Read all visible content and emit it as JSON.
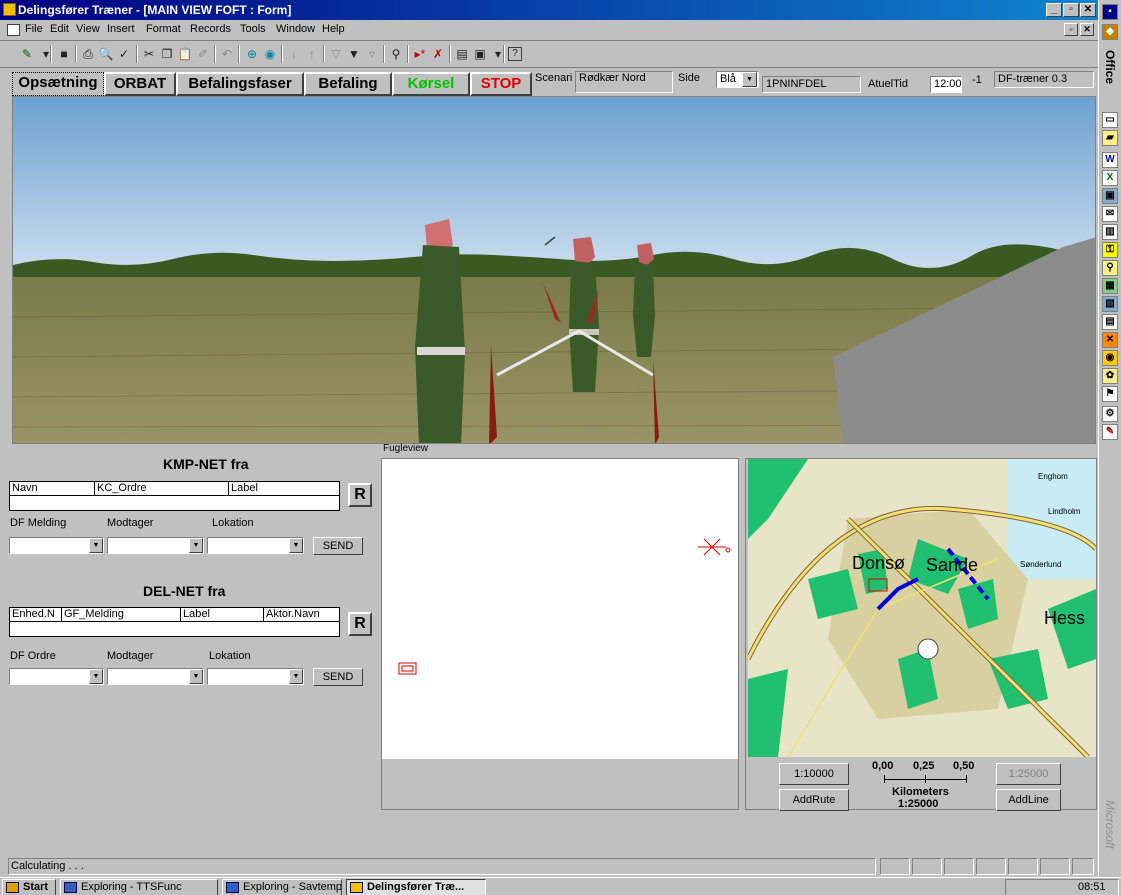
{
  "window": {
    "title": "Delingsfører Træner - [MAIN VIEW FOFT : Form]"
  },
  "menu": {
    "items": [
      "File",
      "Edit",
      "View",
      "Insert",
      "Format",
      "Records",
      "Tools",
      "Window",
      "Help"
    ]
  },
  "toolbar": {
    "icons": [
      "design-view-icon",
      "save-icon",
      "print-icon",
      "print-preview-icon",
      "spelling-icon",
      "cut-icon",
      "copy-icon",
      "paste-icon",
      "format-painter-icon",
      "undo-icon",
      "insert-hyperlink-icon",
      "web-toolbar-icon",
      "sort-ascending-icon",
      "sort-descending-icon",
      "filter-by-selection-icon",
      "filter-by-form-icon",
      "apply-filter-icon",
      "find-icon",
      "new-record-icon",
      "delete-record-icon",
      "database-window-icon",
      "new-object-icon",
      "help-icon"
    ]
  },
  "controls": {
    "tab_opsaetning": "Opsætning",
    "tab_orbat": "ORBAT",
    "tab_befalingsfaser": "Befalingsfaser",
    "tab_befaling": "Befaling",
    "korsel": "Kørsel",
    "stop": "STOP",
    "scenari_label": "Scenari",
    "scenari_value": "Rødkær Nord",
    "side_label": "Side",
    "side_value": "Blå",
    "unit_value": "1PNINFDEL",
    "atueltid_label": "AtuelTid",
    "time_value": "12:00",
    "speed_value": "-1",
    "version": "DF-træner 0.3"
  },
  "kmp": {
    "title": "KMP-NET fra",
    "columns": [
      "Navn",
      "KC_Ordre",
      "Label"
    ],
    "r_label": "R",
    "melding_label": "DF Melding",
    "modtager_label": "Modtager",
    "lokation_label": "Lokation",
    "send_label": "SEND"
  },
  "del": {
    "title": "DEL-NET fra",
    "columns": [
      "Enhed.N",
      "GF_Melding",
      "Label",
      "Aktor.Navn"
    ],
    "r_label": "R",
    "ordre_label": "DF Ordre",
    "modtager_label": "Modtager",
    "lokation_label": "Lokation",
    "send_label": "SEND"
  },
  "fugleview": {
    "label": "Fugleview"
  },
  "map": {
    "place_labels": [
      "Donsø",
      "Sande",
      "Hess",
      "Enghom",
      "Lindholm",
      "Sønderlund"
    ],
    "scale_10000": "1:10000",
    "scale_25000_disabled": "1:25000",
    "addrute": "AddRute",
    "addline": "AddLine",
    "ticks": [
      "0,00",
      "0,25",
      "0,50"
    ],
    "kilometers": "Kilometers",
    "scale_text": "1:25000"
  },
  "status": {
    "text": "Calculating . . ."
  },
  "taskbar": {
    "start": "Start",
    "tasks": [
      "Exploring - TTSFunc",
      "Exploring - Savtemp",
      "Delingsfører Træ..."
    ],
    "clock": "08:51"
  },
  "officebar": {
    "label": "Office",
    "watermark": "Microsoft"
  },
  "colors": {
    "title_start": "#000080",
    "title_end": "#1084d0",
    "korsel": "#00c000",
    "stop": "#e00000",
    "sky": "#8ab4d8",
    "field": "#8a8a5a"
  }
}
